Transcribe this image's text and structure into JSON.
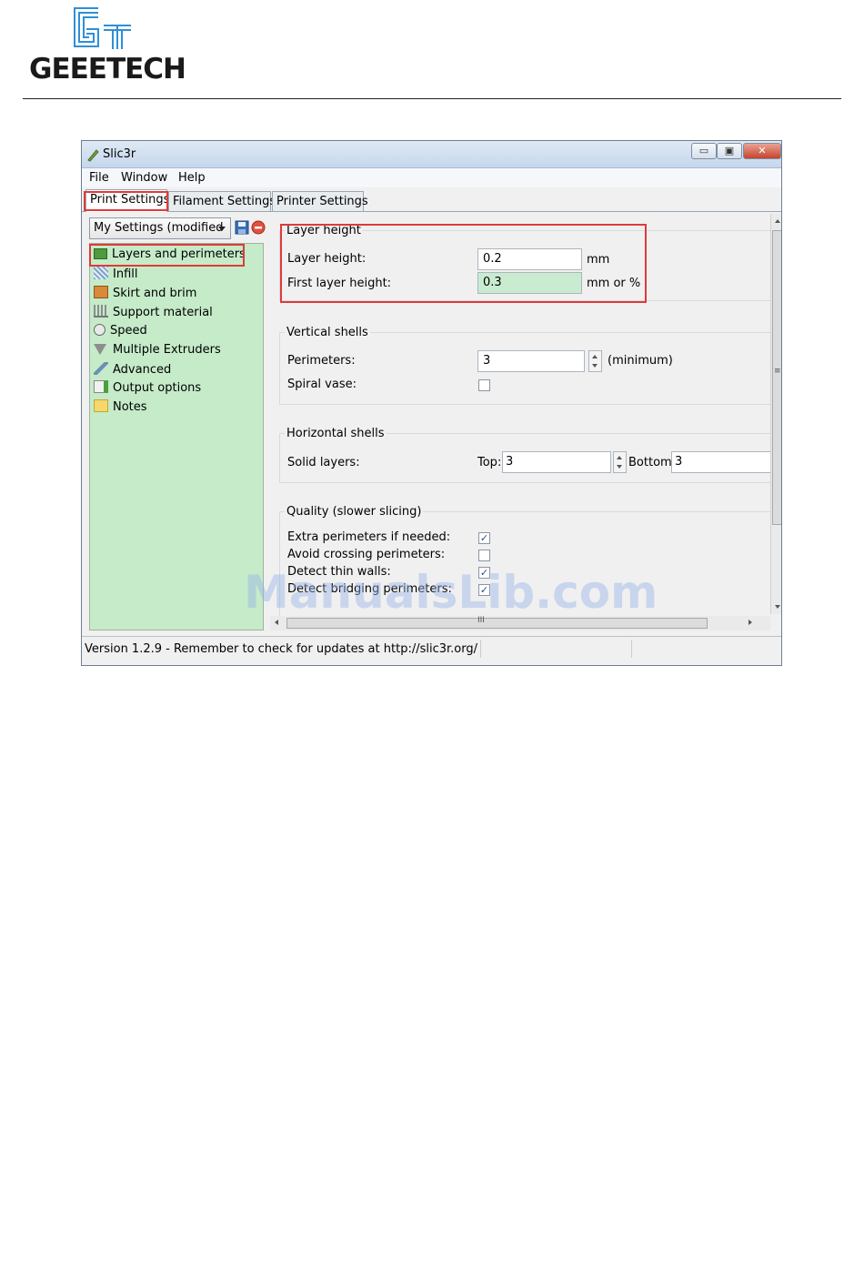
{
  "brand": {
    "name": "GEEETECH",
    "mark": "GT"
  },
  "window": {
    "title": "Slic3r",
    "controls": {
      "minimize": "▭",
      "maximize": "▣",
      "close": "✕"
    }
  },
  "menu": [
    "File",
    "Window",
    "Help"
  ],
  "tabs": [
    "Print Settings",
    "Filament Settings",
    "Printer Settings"
  ],
  "preset": {
    "value": "My Settings (modified"
  },
  "tree": [
    {
      "label": "Layers and perimeters",
      "icon": "layers-icon"
    },
    {
      "label": "Infill",
      "icon": "infill-icon"
    },
    {
      "label": "Skirt and brim",
      "icon": "skirt-icon"
    },
    {
      "label": "Support material",
      "icon": "support-icon"
    },
    {
      "label": "Speed",
      "icon": "speed-icon"
    },
    {
      "label": "Multiple Extruders",
      "icon": "funnel-icon"
    },
    {
      "label": "Advanced",
      "icon": "wrench-icon"
    },
    {
      "label": "Output options",
      "icon": "output-icon"
    },
    {
      "label": "Notes",
      "icon": "notes-icon"
    }
  ],
  "layer_height": {
    "title": "Layer height",
    "layer_height_label": "Layer height:",
    "layer_height_value": "0.2",
    "layer_height_unit": "mm",
    "first_layer_label": "First layer height:",
    "first_layer_value": "0.3",
    "first_layer_unit": "mm or %"
  },
  "vertical_shells": {
    "title": "Vertical shells",
    "perimeters_label": "Perimeters:",
    "perimeters_value": "3",
    "perimeters_unit": "(minimum)",
    "spiral_label": "Spiral vase:",
    "spiral_checked": false
  },
  "horizontal_shells": {
    "title": "Horizontal shells",
    "solid_label": "Solid layers:",
    "top_label": "Top:",
    "top_value": "3",
    "bottom_label": "Bottom:",
    "bottom_value": "3"
  },
  "quality": {
    "title": "Quality (slower slicing)",
    "extra_label": "Extra perimeters if needed:",
    "extra_checked": true,
    "avoid_label": "Avoid crossing perimeters:",
    "avoid_checked": false,
    "thin_label": "Detect thin walls:",
    "thin_checked": true,
    "bridging_label": "Detect bridging perimeters:",
    "bridging_checked": true
  },
  "scroll": {
    "grip": "≡",
    "hgrip": "III"
  },
  "status": "Version 1.2.9 - Remember to check for updates at http://slic3r.org/",
  "watermark": "ManualsLib.com",
  "colors": {
    "tree_bg": "#c5ebc9",
    "highlight": "#e03a3a",
    "field_hl": "#c9ecd0"
  }
}
